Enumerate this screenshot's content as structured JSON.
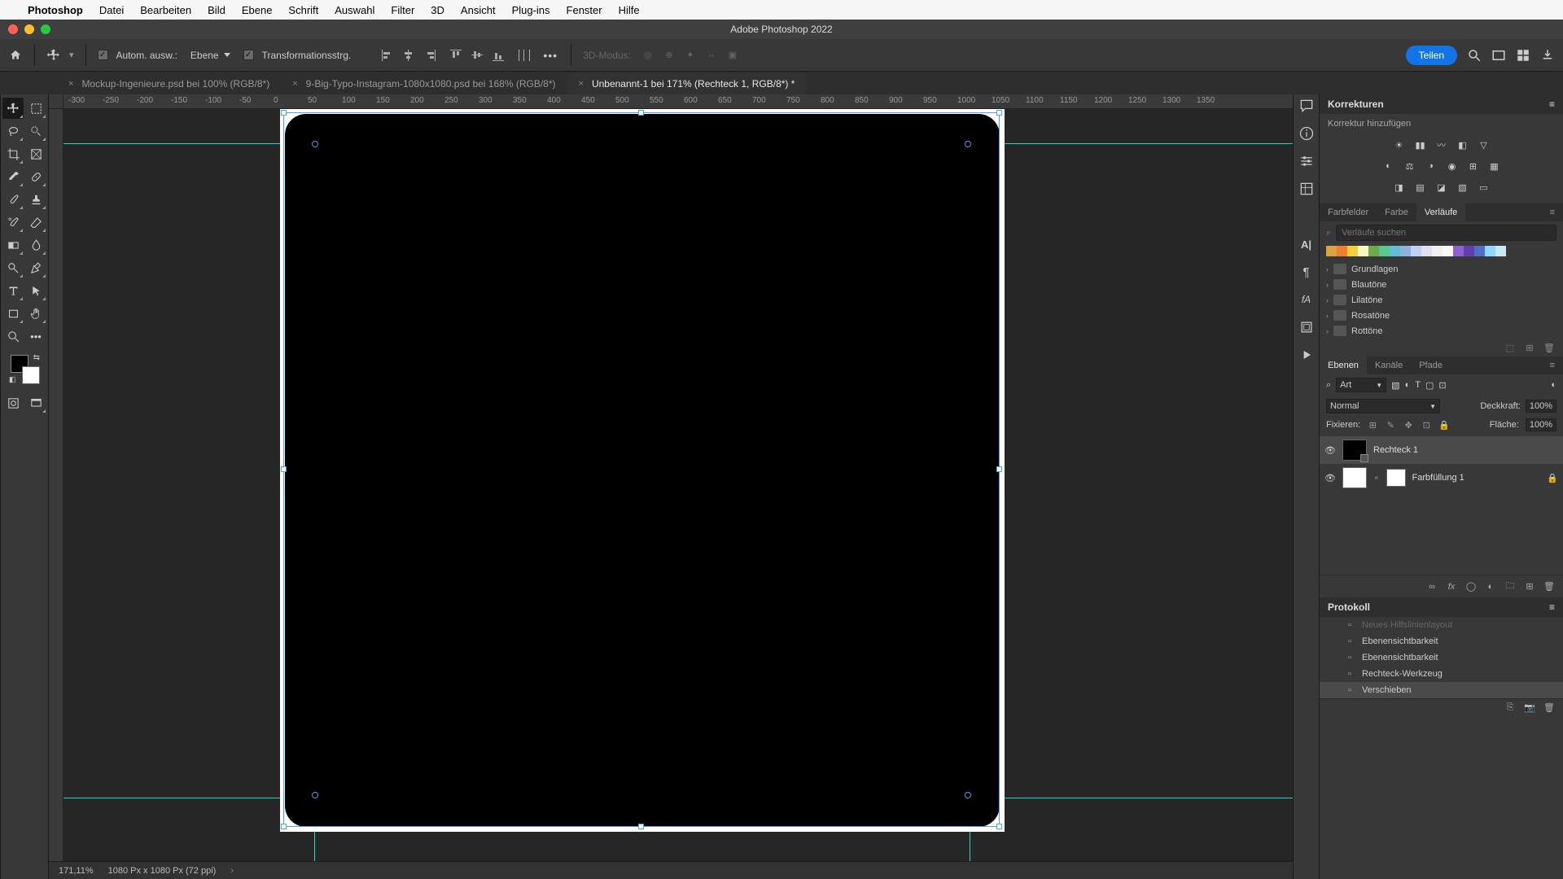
{
  "menubar": {
    "app_name": "Photoshop",
    "items": [
      "Datei",
      "Bearbeiten",
      "Bild",
      "Ebene",
      "Schrift",
      "Auswahl",
      "Filter",
      "3D",
      "Ansicht",
      "Plug-ins",
      "Fenster",
      "Hilfe"
    ]
  },
  "window_title": "Adobe Photoshop 2022",
  "options_bar": {
    "auto_select_label": "Autom. ausw.:",
    "auto_select_target": "Ebene",
    "transform_controls_label": "Transformationsstrg.",
    "mode_3d_label": "3D-Modus:",
    "share_label": "Teilen"
  },
  "doc_tabs": [
    {
      "title": "Mockup-Ingenieure.psd bei 100% (RGB/8*)",
      "active": false
    },
    {
      "title": "9-Big-Typo-Instagram-1080x1080.psd bei 168% (RGB/8*)",
      "active": false
    },
    {
      "title": "Unbenannt-1 bei 171% (Rechteck 1, RGB/8*) *",
      "active": true
    }
  ],
  "ruler_h_ticks": [
    "-300",
    "-250",
    "-200",
    "-150",
    "-100",
    "-50",
    "0",
    "50",
    "100",
    "150",
    "200",
    "250",
    "300",
    "350",
    "400",
    "450",
    "500",
    "550",
    "600",
    "650",
    "700",
    "750",
    "800",
    "850",
    "900",
    "950",
    "1000",
    "1050",
    "1100",
    "1150",
    "1200",
    "1250",
    "1300",
    "1350"
  ],
  "statusbar": {
    "zoom": "171,11%",
    "doc_info": "1080 Px x 1080 Px (72 ppi)"
  },
  "panels": {
    "corrections": {
      "title": "Korrekturen",
      "add_label": "Korrektur hinzufügen"
    },
    "gradients": {
      "tabs": [
        "Farbfelder",
        "Farbe",
        "Verläufe"
      ],
      "active_tab": "Verläufe",
      "search_placeholder": "Verläufe suchen",
      "folders": [
        "Grundlagen",
        "Blautöne",
        "Lilatöne",
        "Rosatöne",
        "Rottöne"
      ],
      "swatch_colors": [
        "#d9a441",
        "#f08030",
        "#f0d040",
        "#f8f8c0",
        "#70a850",
        "#58c890",
        "#60c0d8",
        "#90b0e0",
        "#c0d0f0",
        "#e0e0f0",
        "#f0f0f0",
        "#f8f8f8",
        "#9060d0",
        "#6040b0",
        "#5070c8",
        "#90d8f8",
        "#c8e8f8"
      ]
    },
    "layers": {
      "tabs": [
        "Ebenen",
        "Kanäle",
        "Pfade"
      ],
      "active_tab": "Ebenen",
      "filter_kind": "Art",
      "blend_mode": "Normal",
      "opacity_label": "Deckkraft:",
      "opacity_value": "100%",
      "lock_label": "Fixieren:",
      "fill_label": "Fläche:",
      "fill_value": "100%",
      "items": [
        {
          "name": "Rechteck 1",
          "selected": true,
          "thumb": "black"
        },
        {
          "name": "Farbfüllung 1",
          "selected": false,
          "thumb": "white",
          "locked": true,
          "has_mask": true
        }
      ]
    },
    "history": {
      "title": "Protokoll",
      "items": [
        {
          "name": "Neues Hilfslinienlayout",
          "dim": true
        },
        {
          "name": "Ebenensichtbarkeit"
        },
        {
          "name": "Ebenensichtbarkeit"
        },
        {
          "name": "Rechteck-Werkzeug"
        },
        {
          "name": "Verschieben",
          "selected": true
        }
      ]
    }
  }
}
